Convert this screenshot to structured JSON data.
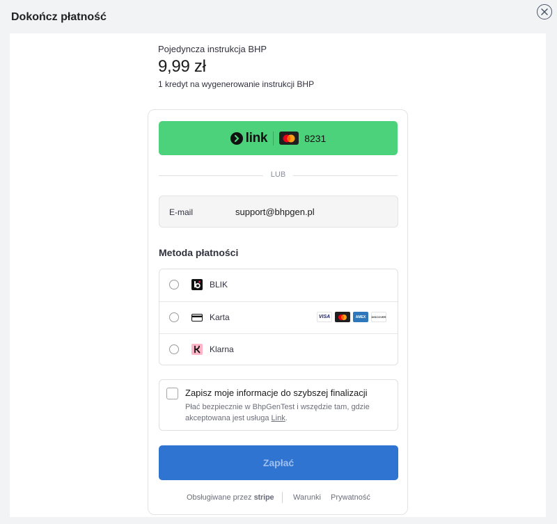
{
  "modal": {
    "title": "Dokończ płatność"
  },
  "product": {
    "name": "Pojedyncza instrukcja BHP",
    "price": "9,99 zł",
    "description": "1 kredyt na wygenerowanie instrukcji BHP"
  },
  "link_button": {
    "brand": "link",
    "card_last4": "8231",
    "color": "#4cd27a"
  },
  "divider": {
    "or_label": "LUB"
  },
  "email": {
    "label": "E-mail",
    "value": "support@bhpgen.pl"
  },
  "payment_method": {
    "title": "Metoda płatności",
    "options": [
      {
        "label": "BLIK",
        "icon": "blik-icon"
      },
      {
        "label": "Karta",
        "icon": "card-icon",
        "brands": [
          "VISA",
          "mastercard",
          "AMEX",
          "DISCOVER"
        ]
      },
      {
        "label": "Klarna",
        "icon": "klarna-icon"
      }
    ]
  },
  "save_info": {
    "title": "Zapisz moje informacje do szybszej finalizacji",
    "description_prefix": "Płać bezpiecznie w BhpGenTest i wszędzie tam, gdzie akceptowana jest usługa ",
    "link_text": "Link",
    "description_suffix": "."
  },
  "pay_button": {
    "label": "Zapłać",
    "color": "#2f74d0"
  },
  "footer": {
    "powered_prefix": "Obsługiwane przez",
    "powered_brand": "stripe",
    "terms": "Warunki",
    "privacy": "Prywatność"
  }
}
